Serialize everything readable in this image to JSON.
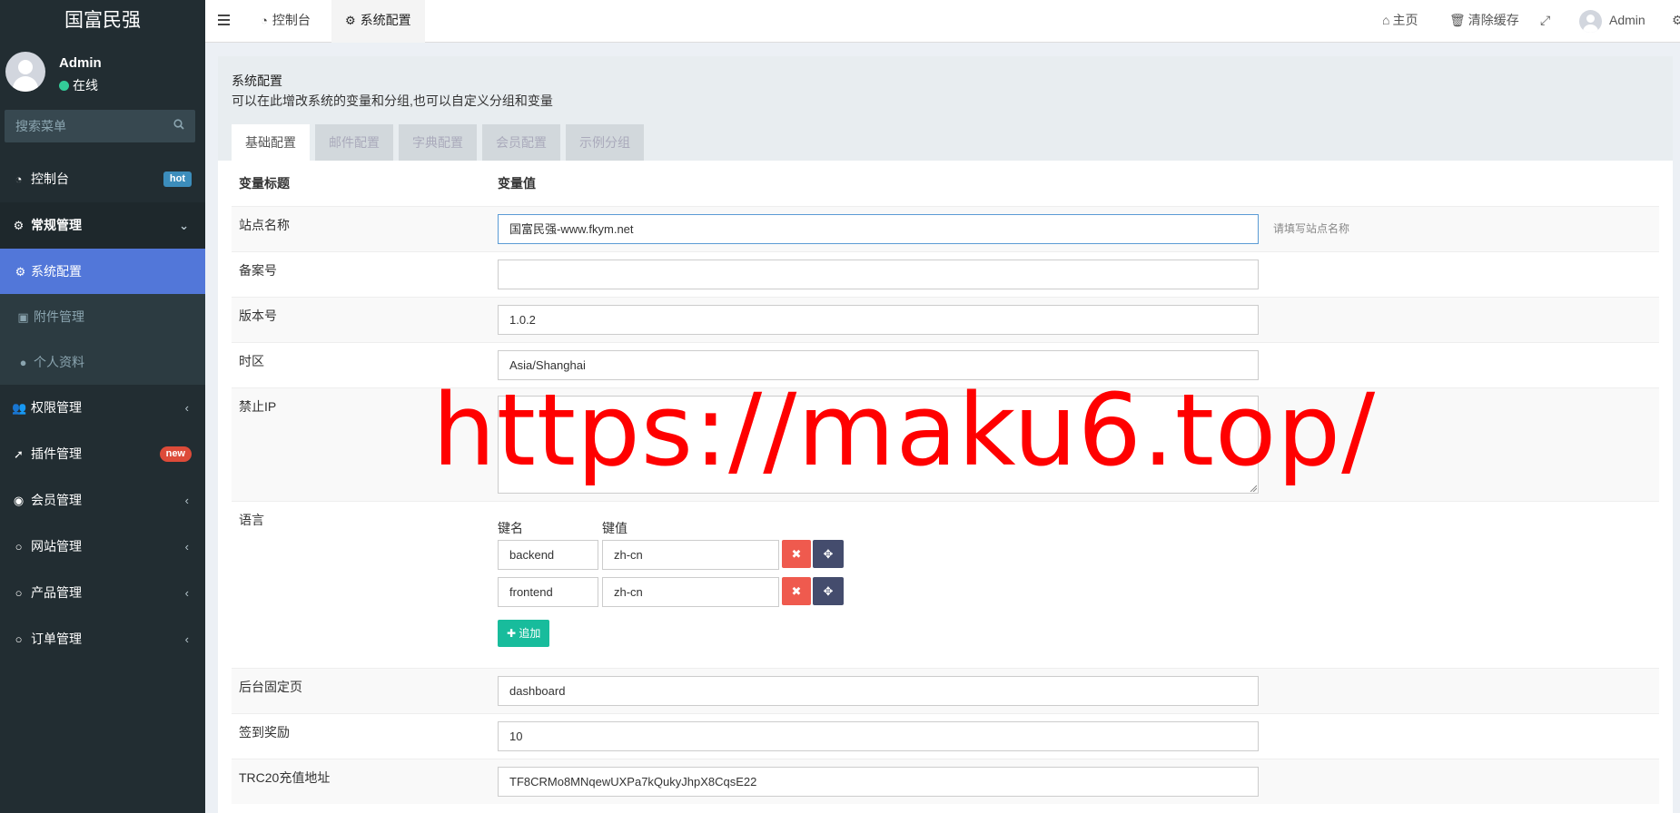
{
  "sidebar": {
    "logo": "国富民强",
    "user": {
      "name": "Admin",
      "status": "在线"
    },
    "search_placeholder": "搜索菜单",
    "menu": [
      {
        "label": "控制台",
        "icon": "dashboard-icon",
        "badge": "hot",
        "badge_color": "#3c8dbc"
      },
      {
        "label": "常规管理",
        "icon": "cogs-icon",
        "expanded": true
      },
      {
        "label": "系统配置",
        "icon": "gear-icon",
        "active": true
      },
      {
        "label": "附件管理",
        "icon": "image-icon"
      },
      {
        "label": "个人资料",
        "icon": "user-icon"
      },
      {
        "label": "权限管理",
        "icon": "group-icon"
      },
      {
        "label": "插件管理",
        "icon": "rocket-icon",
        "badge": "new",
        "badge_color": "#dd4b39"
      },
      {
        "label": "会员管理",
        "icon": "user-circle-icon"
      },
      {
        "label": "网站管理",
        "icon": "circle-icon"
      },
      {
        "label": "产品管理",
        "icon": "circle-icon"
      },
      {
        "label": "订单管理",
        "icon": "circle-icon"
      }
    ]
  },
  "header": {
    "tabs": [
      {
        "label": "控制台",
        "icon": "dashboard-icon"
      },
      {
        "label": "系统配置",
        "icon": "gear-icon",
        "active": true
      }
    ],
    "home": "主页",
    "clear_cache": "清除缓存",
    "user": "Admin"
  },
  "panel": {
    "title": "系统配置",
    "description": "可以在此增改系统的变量和分组,也可以自定义分组和变量",
    "tabs": [
      "基础配置",
      "邮件配置",
      "字典配置",
      "会员配置",
      "示例分组"
    ]
  },
  "table": {
    "col_title": "变量标题",
    "col_value": "变量值",
    "site_name_label": "站点名称",
    "site_name_value": "国富民强-www.fkym.net",
    "site_name_tip": "请填写站点名称",
    "beian_label": "备案号",
    "beian_value": "",
    "version_label": "版本号",
    "version_value": "1.0.2",
    "timezone_label": "时区",
    "timezone_value": "Asia/Shanghai",
    "forbidden_ip_label": "禁止IP",
    "forbidden_ip_value": "",
    "language_label": "语言",
    "key_header": "键名",
    "value_header": "键值",
    "languages": [
      {
        "key": "backend",
        "value": "zh-cn"
      },
      {
        "key": "frontend",
        "value": "zh-cn"
      }
    ],
    "add_label": "追加",
    "fixed_page_label": "后台固定页",
    "fixed_page_value": "dashboard",
    "signin_reward_label": "签到奖励",
    "signin_reward_value": "10",
    "trc20_label": "TRC20充值地址",
    "trc20_value": "TF8CRMo8MNqewUXPa7kQukyJhpX8CqsE22"
  },
  "watermark": "https://maku6.top/",
  "colors": {
    "sidebar_bg": "#222d32",
    "active_menu": "#5277d9",
    "add_button": "#18bc9c",
    "delete_button": "#ef5a4e",
    "move_button": "#444c6d",
    "watermark": "#ff0000"
  }
}
